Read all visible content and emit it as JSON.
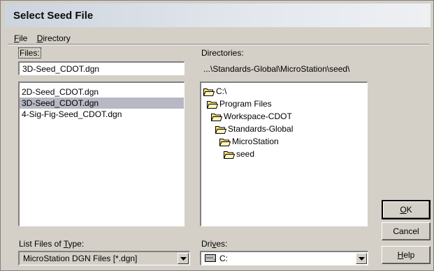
{
  "window": {
    "title": "Select Seed File"
  },
  "menu": [
    {
      "label_u": "F",
      "label_rest": "ile"
    },
    {
      "label_u": "D",
      "label_rest": "irectory"
    }
  ],
  "files": {
    "label": "Files:",
    "input_value": "3D-Seed_CDOT.dgn",
    "items": [
      {
        "name": "2D-Seed_CDOT.dgn",
        "selected": false
      },
      {
        "name": "3D-Seed_CDOT.dgn",
        "selected": true
      },
      {
        "name": "4-Sig-Fig-Seed_CDOT.dgn",
        "selected": false
      }
    ]
  },
  "directories": {
    "label": "Directories:",
    "current_path": "...\\Standards-Global\\MicroStation\\seed\\",
    "items": [
      {
        "name": "C:\\",
        "icon": "open-folder-icon"
      },
      {
        "name": "Program Files",
        "icon": "open-folder-icon"
      },
      {
        "name": "Workspace-CDOT",
        "icon": "open-folder-icon"
      },
      {
        "name": "Standards-Global",
        "icon": "open-folder-icon"
      },
      {
        "name": "MicroStation",
        "icon": "open-folder-icon"
      },
      {
        "name": "seed",
        "icon": "open-folder-icon"
      }
    ]
  },
  "file_type": {
    "label_pre": "List Files of ",
    "label_u": "T",
    "label_post": "ype:",
    "selected": "MicroStation DGN Files [*.dgn]"
  },
  "drives": {
    "label_pre": "Dri",
    "label_u": "v",
    "label_post": "es:",
    "selected": "C:",
    "icon": "hard-drive-icon"
  },
  "buttons": {
    "ok_u": "O",
    "ok_rest": "K",
    "cancel": "Cancel",
    "help_u": "H",
    "help_rest": "elp"
  },
  "colors": {
    "dialog_bg": "#d4d0c8",
    "selection": "#b8b8c4",
    "folder_yellow": "#f7e07a"
  }
}
